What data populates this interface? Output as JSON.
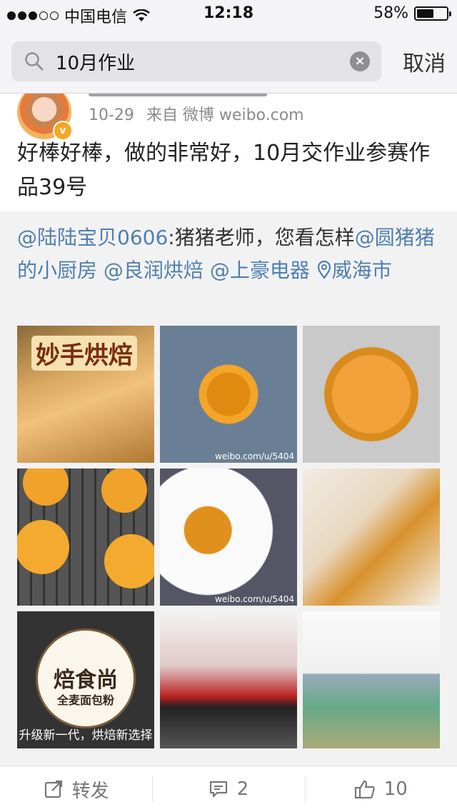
{
  "status_bar": {
    "carrier": "中国电信",
    "time": "12:18",
    "battery": "58%",
    "battery_level": 0.58
  },
  "search": {
    "query": "10月作业",
    "cancel_label": "取消"
  },
  "post": {
    "date": "10-29",
    "source": "来自 微博 weibo.com",
    "text": "好棒好棒，做的非常好，10月交作业参赛作品39号"
  },
  "repost": {
    "author": "@陆陆宝贝0606",
    "body": ":猪猪老师，您看怎样",
    "mentions": [
      "@圆猪猪的小厨房",
      "@良润烘焙",
      "@上豪电器"
    ],
    "location": "威海市"
  },
  "images": {
    "t0_title": "妙手烘焙",
    "t1_mark": "weibo.com/u/5404",
    "t4_mark": "weibo.com/u/5404",
    "t6_seal": "焙食尚",
    "t6_seal_sub": "全麦面包粉",
    "t6_slogan": "升级新一代，烘焙新选择"
  },
  "toolbar": {
    "repost_label": "转发",
    "comment_count": "2",
    "like_count": "10"
  },
  "colors": {
    "link": "#4f7fb0",
    "verified": "#f5a623"
  }
}
